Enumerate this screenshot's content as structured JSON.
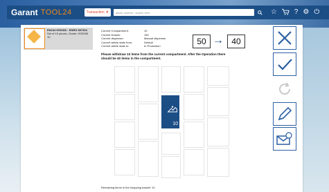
{
  "app": {
    "brand": "Garant",
    "product": "TOOL24",
    "context_label": "Transaction",
    "search_text": "article number / search term",
    "icons": [
      "search-icon",
      "star-icon",
      "cart-icon",
      "help-icon",
      "settings-icon",
      "power-icon"
    ]
  },
  "article": {
    "title": "EN244 HSS926 - ENRG 807304",
    "subtitle": "Set of 10 pieces, Grade: HSS926",
    "qty": "10"
  },
  "info": {
    "compartment_label": "Current Compartment:",
    "compartment_value": "10",
    "drawer_label": "Current Drawer:",
    "drawer_value": "150",
    "dispenser_label": "Current dispenser:",
    "dispenser_value": "Manual dispenser",
    "state_from_label": "Current article state from:",
    "state_from_value": "Default",
    "state_to_label": "Current article state to:",
    "state_to_value": "In Production"
  },
  "instruction": "Please withdraw 10 items from the current compartment. After the Operation there should be 40 items in the compartment.",
  "counts": {
    "from": "50",
    "arrow": "→",
    "to": "40"
  },
  "active_slot_qty": "10",
  "status": "Remaining items in the shopping basket: 10",
  "actions": [
    {
      "name": "cancel-button",
      "icon": "close-icon"
    },
    {
      "name": "confirm-button",
      "icon": "check-icon"
    },
    {
      "name": "refresh-button",
      "icon": "refresh-icon"
    },
    {
      "name": "edit-button",
      "icon": "pencil-icon"
    },
    {
      "name": "message-button",
      "icon": "mail-icon"
    }
  ],
  "colors": {
    "accent": "#1c4e86",
    "brand_orange": "#f08a1c",
    "context_red": "#e0452b"
  }
}
